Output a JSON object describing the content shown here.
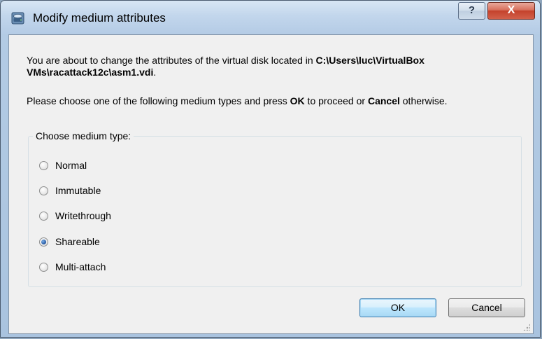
{
  "window": {
    "title": "Modify medium attributes",
    "help_label": "?",
    "close_label": "X"
  },
  "message": {
    "line1_prefix": "You are about to change the attributes of the virtual disk located in ",
    "path": "C:\\Users\\luc\\VirtualBox VMs\\racattack12c\\asm1.vdi",
    "line1_suffix": ".",
    "line2_prefix": "Please choose one of the following medium types and press ",
    "ok_word": "OK",
    "line2_middle": " to proceed or ",
    "cancel_word": "Cancel",
    "line2_suffix": " otherwise."
  },
  "group": {
    "legend": "Choose medium type:",
    "options": [
      {
        "label": "Normal",
        "checked": false
      },
      {
        "label": "Immutable",
        "checked": false
      },
      {
        "label": "Writethrough",
        "checked": false
      },
      {
        "label": "Shareable",
        "checked": true
      },
      {
        "label": "Multi-attach",
        "checked": false
      }
    ]
  },
  "buttons": {
    "ok_label": "OK",
    "cancel_label": "Cancel"
  },
  "icons": {
    "app": "virtual-disk-icon",
    "help": "question-mark-icon",
    "close": "close-x-icon"
  }
}
